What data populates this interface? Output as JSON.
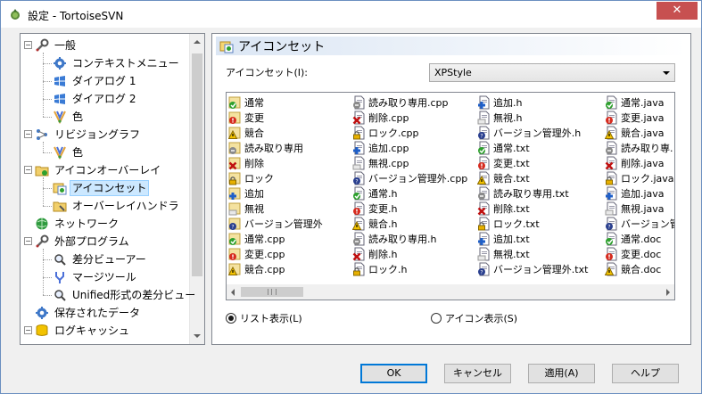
{
  "window": {
    "title": "設定 - TortoiseSVN",
    "close_label": "✕"
  },
  "tree": {
    "items": [
      {
        "label": "一般",
        "icon": "wrench-icon",
        "level": 0,
        "expander": "−"
      },
      {
        "label": "コンテキストメニュー",
        "icon": "gear-icon",
        "level": 1
      },
      {
        "label": "ダイアログ 1",
        "icon": "windows-flag-icon",
        "level": 1
      },
      {
        "label": "ダイアログ 2",
        "icon": "windows-flag-icon",
        "level": 1
      },
      {
        "label": "色",
        "icon": "palette-icon",
        "level": 1
      },
      {
        "label": "リビジョングラフ",
        "icon": "revision-graph-icon",
        "level": 0,
        "expander": "−"
      },
      {
        "label": "色",
        "icon": "palette-icon",
        "level": 1
      },
      {
        "label": "アイコンオーバーレイ",
        "icon": "overlay-folder-icon",
        "level": 0,
        "expander": "−"
      },
      {
        "label": "アイコンセット",
        "icon": "icon-set-icon",
        "level": 1,
        "selected": true
      },
      {
        "label": "オーバーレイハンドラ",
        "icon": "overlay-handler-icon",
        "level": 1
      },
      {
        "label": "ネットワーク",
        "icon": "network-globe-icon",
        "level": 0
      },
      {
        "label": "外部プログラム",
        "icon": "wrench-icon",
        "level": 0,
        "expander": "−"
      },
      {
        "label": "差分ビューアー",
        "icon": "magnifier-icon",
        "level": 1
      },
      {
        "label": "マージツール",
        "icon": "merge-icon",
        "level": 1
      },
      {
        "label": "Unified形式の差分ビュー",
        "icon": "magnifier-icon",
        "level": 1
      },
      {
        "label": "保存されたデータ",
        "icon": "gear-icon",
        "level": 0
      },
      {
        "label": "ログキャッシュ",
        "icon": "database-icon",
        "level": 0,
        "expander": "−"
      }
    ]
  },
  "panel": {
    "title": "アイコンセット",
    "iconset_label": "アイコンセット(I):",
    "iconset_value": "XPStyle",
    "list_columns": [
      [
        "通常",
        "変更",
        "競合",
        "読み取り専用",
        "削除",
        "ロック",
        "追加",
        "無視",
        "バージョン管理外",
        "通常.cpp",
        "変更.cpp",
        "競合.cpp"
      ],
      [
        "読み取り専用.cpp",
        "削除.cpp",
        "ロック.cpp",
        "追加.cpp",
        "無視.cpp",
        "バージョン管理外.cpp",
        "通常.h",
        "変更.h",
        "競合.h",
        "読み取り専用.h",
        "削除.h",
        "ロック.h"
      ],
      [
        "追加.h",
        "無視.h",
        "バージョン管理外.h",
        "通常.txt",
        "変更.txt",
        "競合.txt",
        "読み取り専用.txt",
        "削除.txt",
        "ロック.txt",
        "追加.txt",
        "無視.txt",
        "バージョン管理外.txt"
      ],
      [
        "通常.java",
        "変更.java",
        "競合.java",
        "読み取り専.",
        "削除.java",
        "ロック.java",
        "追加.java",
        "無視.java",
        "バージョン管",
        "通常.doc",
        "変更.doc",
        "競合.doc"
      ]
    ],
    "radio_list": "リスト表示(L)",
    "radio_icon": "アイコン表示(S)"
  },
  "buttons": {
    "ok": "OK",
    "cancel": "キャンセル",
    "apply": "適用(A)",
    "help": "ヘルプ"
  },
  "colors": {
    "normal": "#2ea02e",
    "modified": "#d62b1f",
    "conflict": "#f2c200",
    "readonly": "#8a8a8a",
    "deleted": "#c01010",
    "locked": "#e7b000",
    "added": "#1f5fc8",
    "ignored": "#c0c0c0",
    "unversioned": "#2a3f8f"
  }
}
